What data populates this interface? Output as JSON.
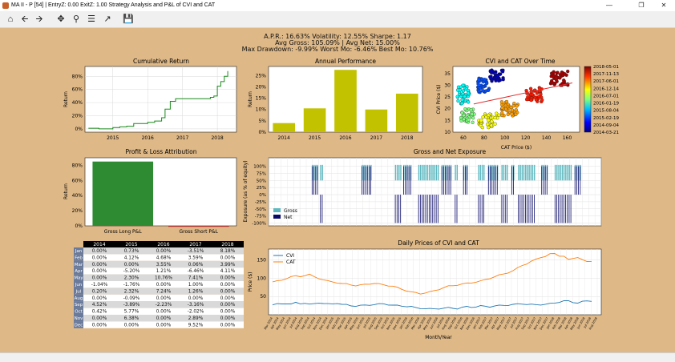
{
  "window": {
    "title": "MA II - P [54]  |  EntryZ: 0.00  ExitZ: 1.00 Strategy Analysis and P&L of CVI and CAT"
  },
  "toolbar": {
    "items": [
      "home-icon",
      "back-icon",
      "forward-icon",
      "pan-icon",
      "zoom-icon",
      "configure-subplots-icon",
      "edit-axes-icon",
      "save-icon"
    ]
  },
  "stats": {
    "line1": "A.P.R.: 16.63%      Volatility: 12.55%      Sharpe: 1.17",
    "line2": "Avg Gross: 105.09%      |      Avg Net: 15.00%",
    "line3": "Max Drawdown: -9.99%      Worst Mo: -6.46%      Best Mo: 10.76%"
  },
  "colors": {
    "background": "#deb887",
    "cum_line": "#1a8a1a",
    "annual_bar": "#c2c200",
    "long_bar": "#2e8b32",
    "short_bar": "#b03030",
    "gross": "#5fb8c0",
    "net": "#0a0a6a",
    "cvi": "#1f77b4",
    "cat": "#ff7f0e",
    "trend": "#e03030"
  },
  "chart_data": [
    {
      "type": "line",
      "title": "Cumulative Return",
      "xlabel": "",
      "ylabel": "Return",
      "x_ticks": [
        "2015",
        "2016",
        "2017",
        "2018"
      ],
      "y_ticks": [
        "0%",
        "20%",
        "40%",
        "60%",
        "80%"
      ],
      "xlim": [
        2014.2,
        2018.55
      ],
      "ylim": [
        -0.05,
        0.95
      ],
      "x": [
        2014.3,
        2014.6,
        2014.8,
        2015.0,
        2015.2,
        2015.4,
        2015.6,
        2015.8,
        2016.0,
        2016.2,
        2016.4,
        2016.5,
        2016.65,
        2016.8,
        2017.0,
        2017.2,
        2017.4,
        2017.6,
        2017.8,
        2017.9,
        2018.0,
        2018.1,
        2018.2,
        2018.3
      ],
      "y": [
        0.01,
        0.0,
        0.0,
        0.02,
        0.03,
        0.04,
        0.08,
        0.08,
        0.1,
        0.12,
        0.17,
        0.3,
        0.42,
        0.46,
        0.46,
        0.46,
        0.46,
        0.46,
        0.48,
        0.5,
        0.65,
        0.72,
        0.8,
        0.88
      ]
    },
    {
      "type": "bar",
      "title": "Annual Performance",
      "xlabel": "",
      "ylabel": "Return",
      "categories": [
        "2014",
        "2015",
        "2016",
        "2017",
        "2018"
      ],
      "values": [
        0.04,
        0.105,
        0.275,
        0.1,
        0.17
      ],
      "y_ticks": [
        "0%",
        "5%",
        "10%",
        "15%",
        "20%",
        "25%"
      ],
      "ylim": [
        0,
        0.29
      ]
    },
    {
      "type": "scatter",
      "title": "CVI and CAT Over Time",
      "xlabel": "CAT Price ($)",
      "ylabel": "CVI Price ($)",
      "x_ticks": [
        "60",
        "80",
        "100",
        "120",
        "140",
        "160"
      ],
      "y_ticks": [
        "10",
        "15",
        "20",
        "25",
        "30",
        "35"
      ],
      "xlim": [
        50,
        172
      ],
      "ylim": [
        10,
        38
      ],
      "colorbar_labels": [
        "2018-05-01",
        "2017-11-13",
        "2017-06-01",
        "2016-12-14",
        "2016-07-01",
        "2016-01-19",
        "2015-08-04",
        "2015-02-19",
        "2014-09-04",
        "2014-03-21"
      ],
      "clusters": [
        {
          "cx": 92,
          "cy": 34,
          "sx": 7,
          "sy": 2.5,
          "t": 0.05
        },
        {
          "cx": 80,
          "cy": 30,
          "sx": 6,
          "sy": 3,
          "t": 0.2
        },
        {
          "cx": 60,
          "cy": 26,
          "sx": 6,
          "sy": 4,
          "t": 0.38
        },
        {
          "cx": 64,
          "cy": 17,
          "sx": 7,
          "sy": 3,
          "t": 0.5
        },
        {
          "cx": 85,
          "cy": 15,
          "sx": 10,
          "sy": 3,
          "t": 0.62
        },
        {
          "cx": 105,
          "cy": 20,
          "sx": 8,
          "sy": 3,
          "t": 0.72
        },
        {
          "cx": 128,
          "cy": 26,
          "sx": 8,
          "sy": 3,
          "t": 0.85
        },
        {
          "cx": 152,
          "cy": 33,
          "sx": 9,
          "sy": 3,
          "t": 0.96
        }
      ],
      "trend": {
        "x": [
          70,
          165
        ],
        "y": [
          22,
          31
        ]
      }
    },
    {
      "type": "bar",
      "title": "Profit & Loss Attribution",
      "xlabel": "",
      "ylabel": "Return",
      "categories": [
        "Gross Long P&L",
        "Gross Short P&L"
      ],
      "values": [
        0.85,
        -0.005
      ],
      "y_ticks": [
        "0%",
        "20%",
        "40%",
        "60%",
        "80%"
      ],
      "ylim": [
        0,
        0.9
      ]
    },
    {
      "type": "bar",
      "title": "Gross and Net Exposure",
      "xlabel": "",
      "ylabel": "Exposure (as % of equity)",
      "y_ticks": [
        "-100%",
        "-75%",
        "-50%",
        "-25%",
        "0%",
        "25%",
        "50%",
        "75%",
        "100%"
      ],
      "ylim": [
        -1.1,
        1.3
      ],
      "series": [
        {
          "name": "Gross"
        },
        {
          "name": "Net"
        }
      ],
      "trade_periods": [
        [
          0.13,
          0.15,
          1
        ],
        [
          0.155,
          0.165,
          -1
        ],
        [
          0.28,
          0.31,
          1
        ],
        [
          0.38,
          0.4,
          -1
        ],
        [
          0.405,
          0.43,
          1
        ],
        [
          0.45,
          0.51,
          -1
        ],
        [
          0.52,
          0.55,
          1
        ],
        [
          0.56,
          0.57,
          -1
        ],
        [
          0.585,
          0.6,
          1
        ],
        [
          0.63,
          0.65,
          -1
        ],
        [
          0.66,
          0.69,
          1
        ],
        [
          0.7,
          0.72,
          -1
        ],
        [
          0.73,
          0.74,
          1
        ],
        [
          0.75,
          0.8,
          -1
        ],
        [
          0.82,
          0.84,
          1
        ],
        [
          0.86,
          0.91,
          -1
        ],
        [
          0.92,
          0.94,
          1
        ]
      ]
    },
    {
      "type": "table",
      "title": "",
      "columns": [
        "",
        "2014",
        "2015",
        "2016",
        "2017",
        "2018"
      ],
      "rows": [
        [
          "Jan",
          "0.00%",
          "0.73%",
          "0.00%",
          "-3.51%",
          "8.18%"
        ],
        [
          "Feb",
          "0.00%",
          "4.12%",
          "4.68%",
          "3.59%",
          "0.00%"
        ],
        [
          "Mar",
          "0.00%",
          "0.00%",
          "3.55%",
          "0.06%",
          "3.99%"
        ],
        [
          "Apr",
          "0.00%",
          "-5.20%",
          "1.21%",
          "-6.46%",
          "4.11%"
        ],
        [
          "May",
          "0.00%",
          "2.30%",
          "10.76%",
          "7.41%",
          "0.00%"
        ],
        [
          "Jun",
          "-1.04%",
          "-1.76%",
          "0.00%",
          "1.00%",
          "0.00%"
        ],
        [
          "Jul",
          "0.20%",
          "2.32%",
          "7.24%",
          "1.26%",
          "0.00%"
        ],
        [
          "Aug",
          "0.00%",
          "-0.09%",
          "0.00%",
          "0.00%",
          "0.00%"
        ],
        [
          "Sep",
          "4.52%",
          "-3.89%",
          "-2.23%",
          "-3.16%",
          "0.00%"
        ],
        [
          "Oct",
          "0.42%",
          "5.77%",
          "0.00%",
          "-2.02%",
          "0.00%"
        ],
        [
          "Nov",
          "0.00%",
          "6.38%",
          "0.00%",
          "2.89%",
          "0.00%"
        ],
        [
          "Dec",
          "0.00%",
          "0.00%",
          "0.00%",
          "9.52%",
          "0.00%"
        ]
      ]
    },
    {
      "type": "line",
      "title": "Daily Prices of CVI and CAT",
      "xlabel": "Month/Year",
      "ylabel": "Price ($)",
      "y_ticks": [
        "50",
        "100",
        "150"
      ],
      "ylim": [
        0,
        180
      ],
      "series": [
        {
          "name": "CVI",
          "values": [
            27,
            29,
            30,
            31,
            29,
            33,
            31,
            32,
            28,
            30,
            33,
            31,
            29,
            30,
            32,
            28,
            27,
            25,
            24,
            25,
            26,
            27,
            28,
            29,
            30,
            28,
            26,
            25,
            24,
            23,
            22,
            19,
            18,
            17,
            16,
            16,
            17,
            18,
            19,
            18,
            17,
            20,
            22,
            21,
            22,
            24,
            23,
            22,
            24,
            25,
            26,
            27,
            28,
            29,
            30,
            29,
            28,
            27,
            28,
            29,
            30,
            32,
            35,
            38,
            37,
            34,
            33,
            36,
            37,
            38
          ]
        },
        {
          "name": "CAT",
          "values": [
            90,
            92,
            95,
            100,
            104,
            106,
            105,
            108,
            110,
            104,
            100,
            96,
            92,
            90,
            88,
            85,
            84,
            82,
            80,
            81,
            83,
            85,
            86,
            84,
            82,
            80,
            78,
            74,
            70,
            66,
            62,
            60,
            58,
            60,
            62,
            66,
            70,
            74,
            78,
            80,
            82,
            84,
            86,
            88,
            90,
            92,
            96,
            100,
            104,
            108,
            112,
            116,
            120,
            128,
            136,
            140,
            146,
            152,
            158,
            160,
            166,
            168,
            162,
            160,
            150,
            155,
            158,
            150,
            145,
            147
          ]
        }
      ],
      "x_tick_labels": [
        "Mar 2014",
        "Apr 2014",
        "May 2014",
        "Jun 2014",
        "Jul 2014",
        "Aug 2014",
        "Sep 2014",
        "Oct 2014",
        "Nov 2014",
        "Dec 2014",
        "Jan 2015",
        "Feb 2015",
        "Mar 2015",
        "Apr 2015",
        "May 2015",
        "Jun 2015",
        "Jul 2015",
        "Aug 2015",
        "Sep 2015",
        "Oct 2015",
        "Nov 2015",
        "Dec 2015",
        "Jan 2016",
        "Feb 2016",
        "Mar 2016",
        "Apr 2016",
        "May 2016",
        "Jun 2016",
        "Jul 2016",
        "Aug 2016",
        "Sep 2016",
        "Oct 2016",
        "Nov 2016",
        "Dec 2016",
        "Jan 2017",
        "Feb 2017",
        "Mar 2017",
        "Apr 2017",
        "May 2017",
        "Jun 2017",
        "Jul 2017",
        "Aug 2017",
        "Sep 2017",
        "Oct 2017",
        "Nov 2017",
        "Dec 2017",
        "Jan 2018",
        "Feb 2018",
        "Mar 2018",
        "Apr 2018",
        "May 2018",
        "Jun 2018",
        "Jul 2018",
        "Aug 2018"
      ]
    }
  ]
}
